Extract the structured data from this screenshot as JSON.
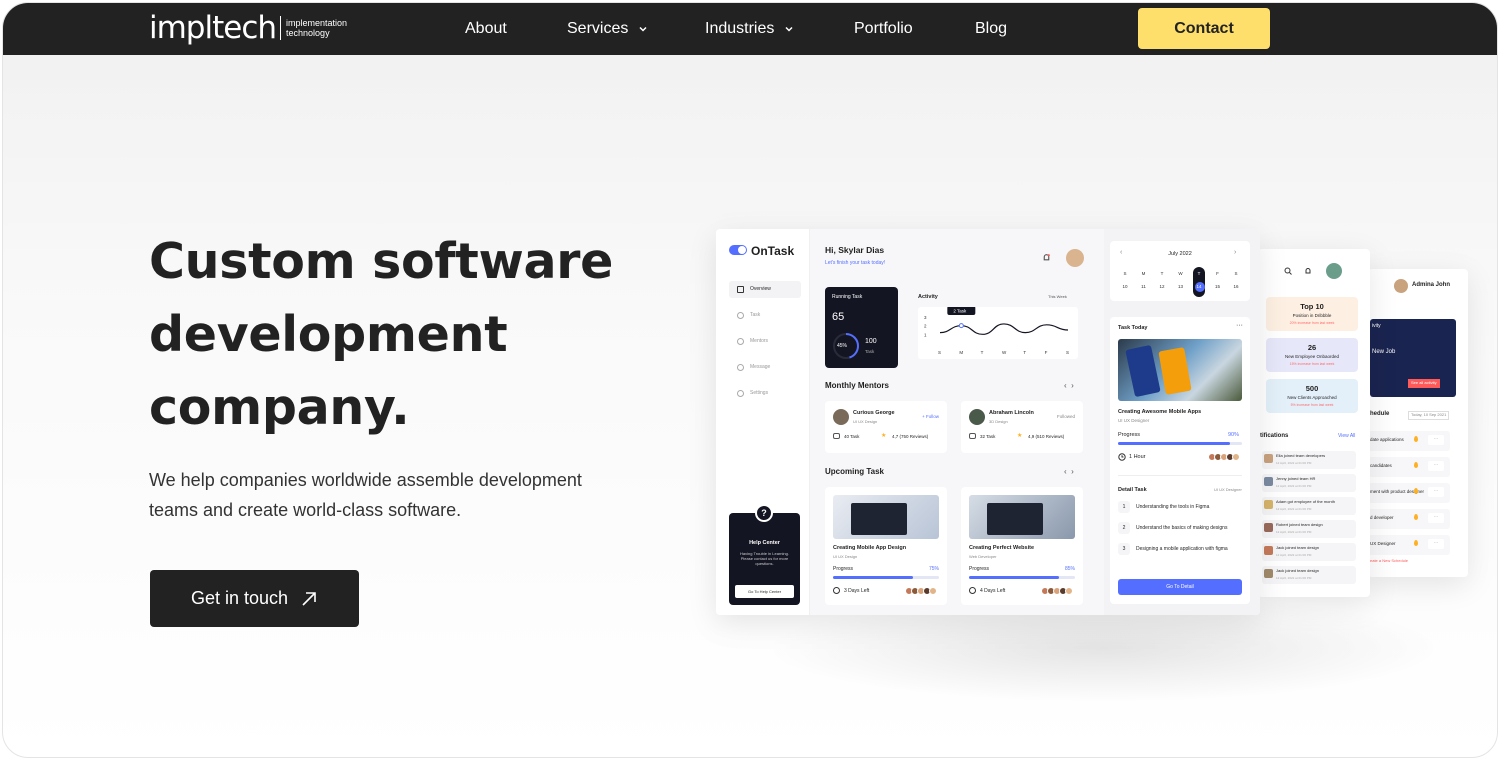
{
  "nav": {
    "logo": "impltech",
    "tagline": [
      "implementation",
      "technology"
    ],
    "links": [
      "About",
      "Services",
      "Industries",
      "Portfolio",
      "Blog"
    ],
    "contact": "Contact"
  },
  "hero": {
    "title": [
      "Custom software",
      "development",
      "company."
    ],
    "subtitle": [
      "We help companies worldwide assemble development",
      "teams and create world-class software."
    ],
    "cta": "Get in touch"
  },
  "dash": {
    "brand": "OnTask",
    "menu": [
      "Overview",
      "Task",
      "Mentors",
      "Message",
      "Settings"
    ],
    "help": {
      "title": "Help Center",
      "text": [
        "Having Trouble in Learning.",
        "Please contact us for more",
        "questions."
      ],
      "button": "Go To Help Center"
    },
    "greeting": "Hi, Skylar Dias",
    "greeting_sub": "Let's finish your task today!",
    "running": {
      "label": "Running Task",
      "count": "65",
      "pct": "45%",
      "total": "100",
      "unit": "Task",
      "progress": 0.45
    },
    "activity": {
      "label": "Activity",
      "range": "This Week",
      "tip": "2 Task",
      "yticks": [
        "3",
        "2",
        "1"
      ],
      "days": [
        "S",
        "M",
        "T",
        "W",
        "T",
        "F",
        "S"
      ],
      "values": [
        1.2,
        2.0,
        1.0,
        2.2,
        1.2,
        2.1,
        1.5
      ]
    },
    "mentors": {
      "label": "Monthly Mentors",
      "items": [
        {
          "name": "Curious George",
          "role": "UI UX Design",
          "action": "+ Follow",
          "tasks": "40 Task",
          "rating": "4,7 (750 Reviews)"
        },
        {
          "name": "Abraham Lincoln",
          "role": "3D Design",
          "action": "Followed",
          "tasks": "32 Task",
          "rating": "4,9 (510 Reviews)"
        }
      ]
    },
    "upcoming": {
      "label": "Upcoming Task",
      "items": [
        {
          "title": "Creating Mobile App Design",
          "cat": "UI UX Design",
          "progress_label": "Progress",
          "pct": "75%",
          "progress": 0.75,
          "left": "3 Days Left"
        },
        {
          "title": "Creating Perfect Website",
          "cat": "Web Developer",
          "progress_label": "Progress",
          "pct": "85%",
          "progress": 0.85,
          "left": "4 Days Left"
        }
      ]
    },
    "calendar": {
      "month": "July 2022",
      "dow": [
        "S",
        "M",
        "T",
        "W",
        "T",
        "F",
        "S"
      ],
      "dates": [
        "10",
        "11",
        "12",
        "13",
        "14",
        "15",
        "16"
      ],
      "active": 4
    },
    "today": {
      "label": "Task Today",
      "title": "Creating Awesome Mobile Apps",
      "cat": "UI UX Designer",
      "progress_label": "Progress",
      "pct": "90%",
      "progress": 0.9,
      "time": "1 Hour",
      "detail_label": "Detail Task",
      "detail_cat": "UI UX Designer",
      "steps": [
        {
          "n": "1",
          "text": "Understanding the tools in Figma"
        },
        {
          "n": "2",
          "text": "Understand the basics of making designs"
        },
        {
          "n": "3",
          "text": "Designing a mobile application with figma"
        }
      ],
      "button": "Go To Detail"
    }
  },
  "card2": {
    "stats": [
      {
        "num": "Top 10",
        "label": "Position in Dribbble",
        "note": "20% increase from last week"
      },
      {
        "num": "26",
        "label": "New Employee Onbaorded",
        "note": "15% increase from last week"
      },
      {
        "num": "500",
        "label": "New Clients Approached",
        "note": "5% increase from last week"
      }
    ],
    "notif_label": "tifications",
    "view": "View All",
    "notifs": [
      {
        "t": "Ella joined team developers",
        "d": "12 April, 2022 at 01:00 PM"
      },
      {
        "t": "Jenny joined team HR",
        "d": "12 April, 2022 at 01:00 PM"
      },
      {
        "t": "Adam got employee of the month",
        "d": "12 April, 2022 at 01:00 PM"
      },
      {
        "t": "Robert joined team design",
        "d": "12 April, 2022 at 01:00 PM"
      },
      {
        "t": "Jack joined team design",
        "d": "12 April, 2022 at 01:00 PM"
      },
      {
        "t": "Jack joined team design",
        "d": "12 April, 2022 at 01:00 PM"
      }
    ]
  },
  "card3": {
    "user": "Admina John",
    "banner_title": "ivity",
    "banner_sub": "New Job",
    "banner_btn": "See all activity",
    "sched_label": "hedule",
    "sched_date": "Today, 10 Sep 2021",
    "items": [
      "date applications",
      "candidates",
      "ment with product designer",
      "d developer",
      "UX Designer"
    ],
    "new": "eate a New Schedule"
  },
  "colors": {
    "accent": "#546fff",
    "nav": "#222222",
    "contact": "#fedf6b"
  }
}
